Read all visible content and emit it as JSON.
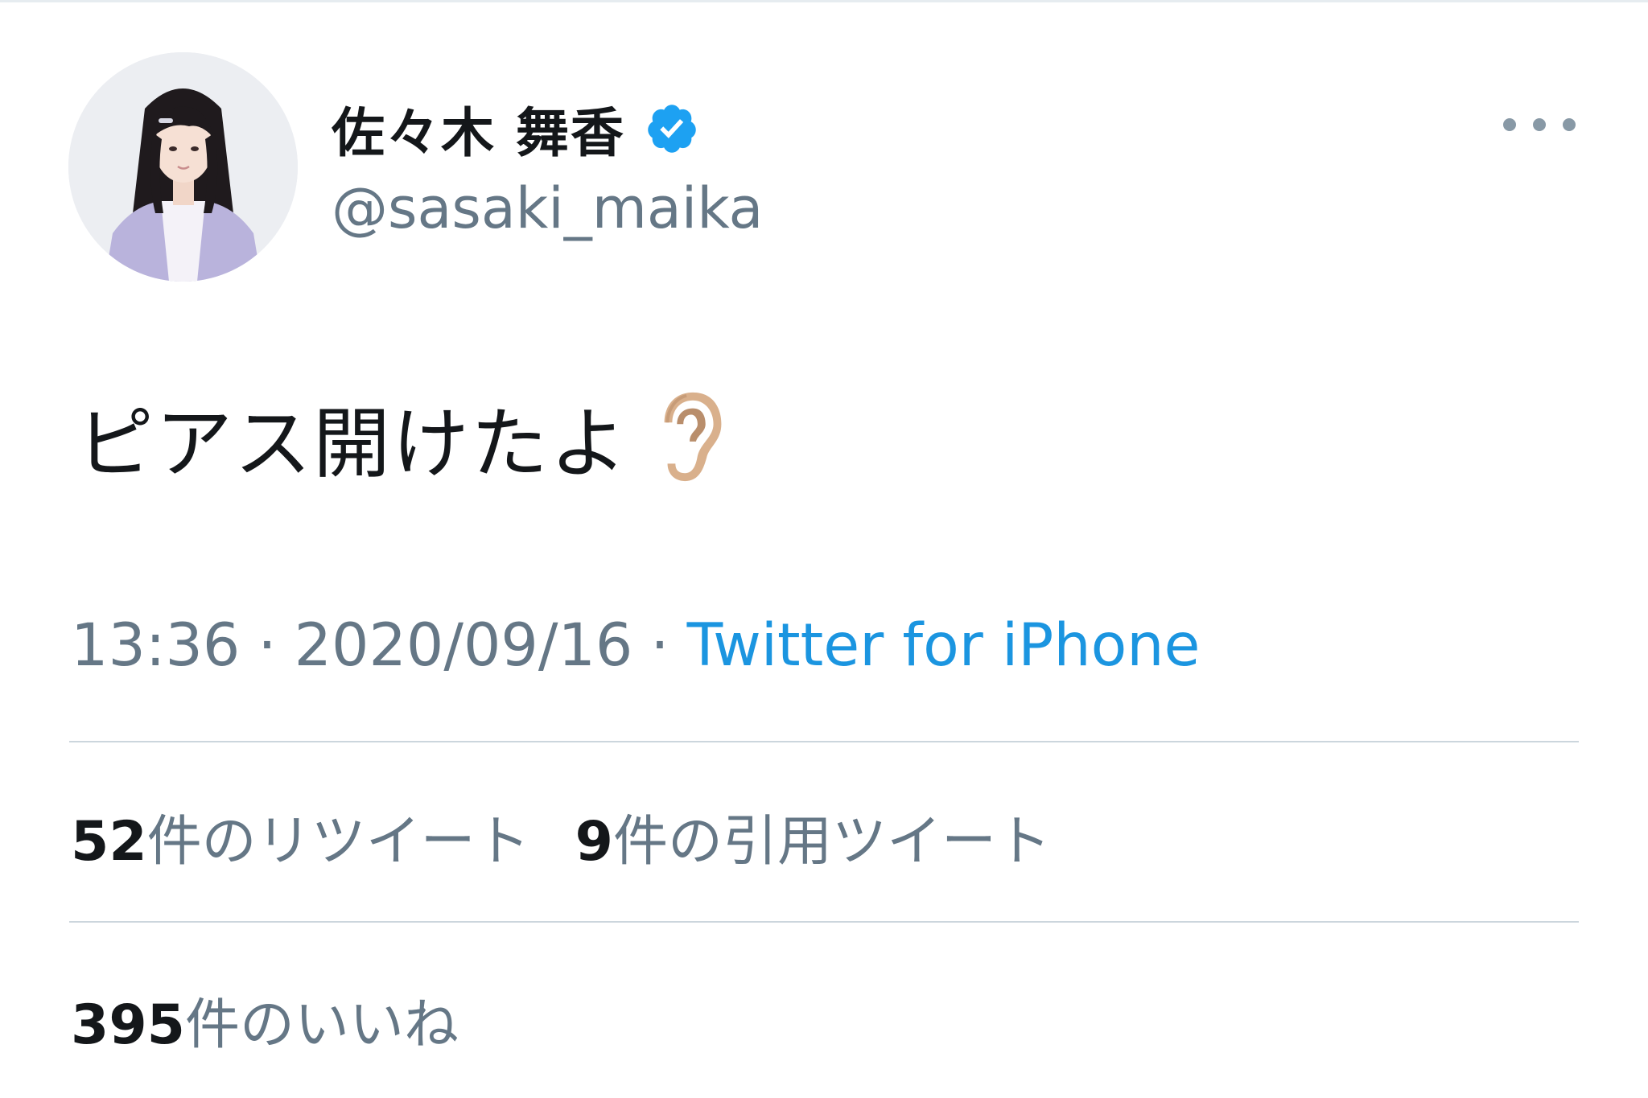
{
  "user": {
    "display_name": "佐々木 舞香",
    "handle": "@sasaki_maika",
    "verified_icon": "verified-badge-icon",
    "avatar_icon": "profile-photo"
  },
  "tweet": {
    "text": "ピアス開けたよ",
    "emoji_icon": "ear-emoji"
  },
  "meta": {
    "time": "13:36",
    "separator": "·",
    "date": "2020/09/16",
    "source": "Twitter for iPhone"
  },
  "stats": {
    "retweets": {
      "count": "52",
      "label": "件のリツイート"
    },
    "quotes": {
      "count": "9",
      "label": "件の引用ツイート"
    },
    "likes": {
      "count": "395",
      "label": "件のいいね"
    }
  },
  "more_icon": "more-options-icon",
  "colors": {
    "text": "#14171a",
    "secondary": "#657786",
    "link": "#1b95e0",
    "verified": "#1da1f2",
    "divider": "#ccd6dd"
  }
}
